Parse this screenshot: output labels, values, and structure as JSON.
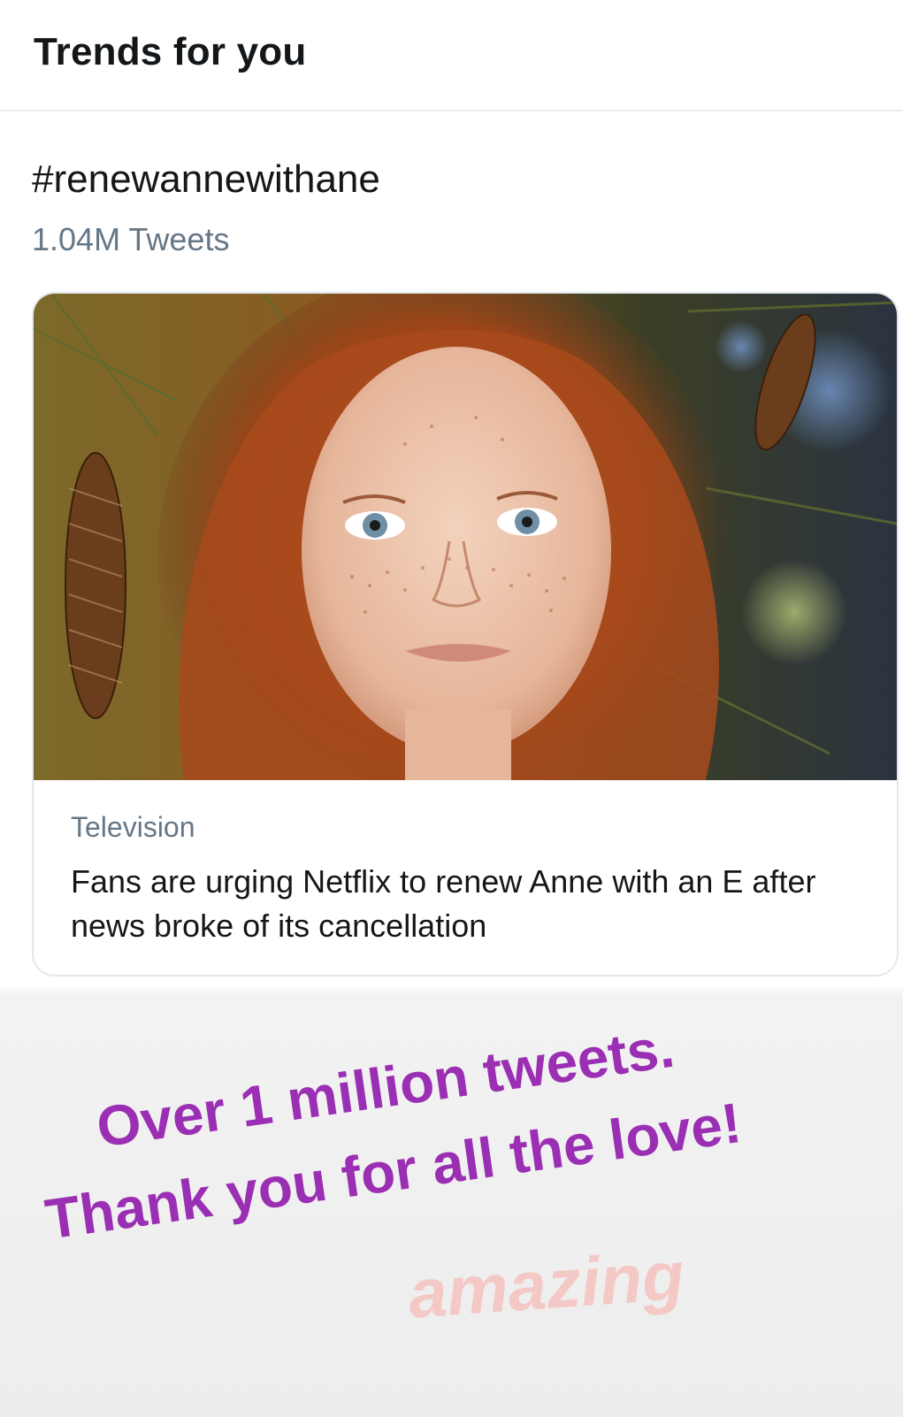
{
  "header": {
    "title": "Trends for you"
  },
  "trend": {
    "hashtag": "#renewannewithane",
    "tweet_count": "1.04M Tweets"
  },
  "card": {
    "category": "Television",
    "headline": "Fans are urging Netflix to renew Anne with an E after news broke of its cancellation"
  },
  "story_overlay": {
    "line1": "Over 1 million tweets.",
    "line2": "Thank you for all the love!",
    "sticker": "amazing",
    "text_color": "#9b2fb4"
  }
}
